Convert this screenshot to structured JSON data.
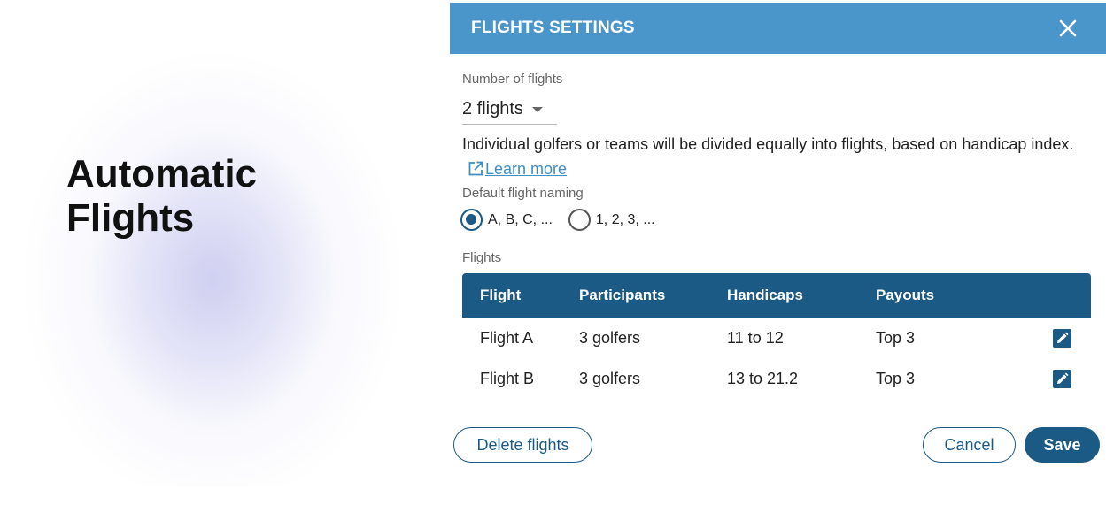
{
  "hero": {
    "title": "Automatic Flights"
  },
  "dialog": {
    "title": "FLIGHTS SETTINGS",
    "number_label": "Number of flights",
    "number_value": "2 flights",
    "description": "Individual golfers or teams will be divided equally into flights, based on handicap index.",
    "learn_more": "Learn more",
    "naming_label": "Default flight naming",
    "naming_options": [
      {
        "label": "A, B, C, ...",
        "selected": true
      },
      {
        "label": "1, 2, 3, ...",
        "selected": false
      }
    ],
    "flights_label": "Flights",
    "table": {
      "headers": [
        "Flight",
        "Participants",
        "Handicaps",
        "Payouts"
      ],
      "rows": [
        {
          "flight": "Flight A",
          "participants": "3 golfers",
          "handicaps": "11 to 12",
          "payouts": "Top 3"
        },
        {
          "flight": "Flight B",
          "participants": "3 golfers",
          "handicaps": "13 to 21.2",
          "payouts": "Top 3"
        }
      ]
    },
    "buttons": {
      "delete": "Delete flights",
      "cancel": "Cancel",
      "save": "Save"
    }
  },
  "colors": {
    "header_bg": "#4a95c9",
    "primary": "#1a5a85",
    "link": "#3f8fc4"
  },
  "icons": {
    "close": "close-icon",
    "external": "external-link-icon",
    "edit": "pencil-icon",
    "dropdown": "caret-down-icon"
  }
}
